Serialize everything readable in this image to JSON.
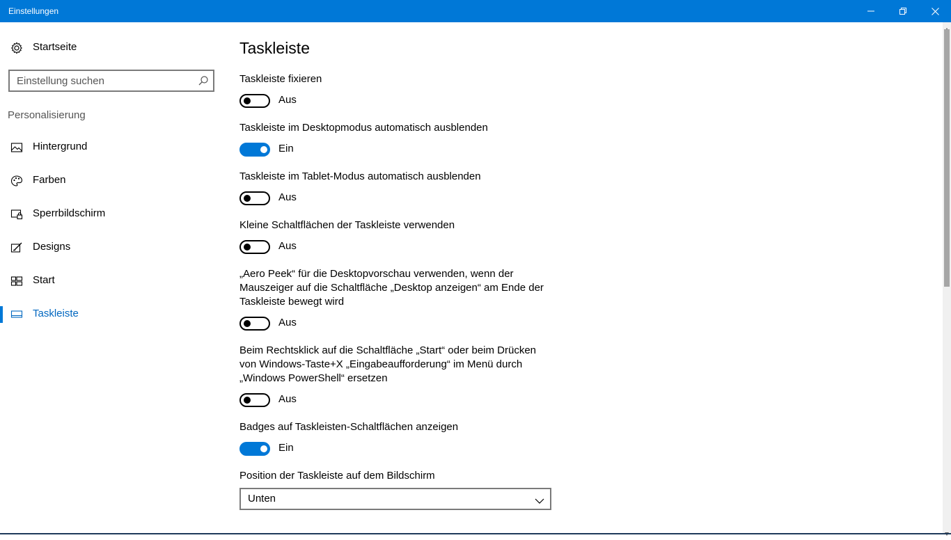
{
  "window": {
    "title": "Einstellungen",
    "accent_color": "#0078d7"
  },
  "sidebar": {
    "home_label": "Startseite",
    "search": {
      "placeholder": "Einstellung suchen",
      "value": ""
    },
    "section_title": "Personalisierung",
    "items": [
      {
        "label": "Hintergrund",
        "icon": "picture-icon",
        "active": false
      },
      {
        "label": "Farben",
        "icon": "palette-icon",
        "active": false
      },
      {
        "label": "Sperrbildschirm",
        "icon": "lock-screen-icon",
        "active": false
      },
      {
        "label": "Designs",
        "icon": "designs-icon",
        "active": false
      },
      {
        "label": "Start",
        "icon": "start-icon",
        "active": false
      },
      {
        "label": "Taskleiste",
        "icon": "taskbar-icon",
        "active": true
      }
    ]
  },
  "main": {
    "title": "Taskleiste",
    "settings": [
      {
        "label": "Taskleiste fixieren",
        "on": false,
        "state_label": "Aus"
      },
      {
        "label": "Taskleiste im Desktopmodus automatisch ausblenden",
        "on": true,
        "state_label": "Ein"
      },
      {
        "label": "Taskleiste im Tablet-Modus automatisch ausblenden",
        "on": false,
        "state_label": "Aus"
      },
      {
        "label": "Kleine Schaltflächen der Taskleiste verwenden",
        "on": false,
        "state_label": "Aus"
      },
      {
        "label": "„Aero Peek“ für die Desktopvorschau verwenden, wenn der Mauszeiger auf die Schaltfläche „Desktop anzeigen“ am Ende der Taskleiste bewegt wird",
        "on": false,
        "state_label": "Aus"
      },
      {
        "label": "Beim Rechtsklick auf die Schaltfläche „Start“ oder beim Drücken von Windows-Taste+X „Eingabeaufforderung“ im Menü durch „Windows PowerShell“ ersetzen",
        "on": false,
        "state_label": "Aus"
      },
      {
        "label": "Badges auf Taskleisten-Schaltflächen anzeigen",
        "on": true,
        "state_label": "Ein"
      }
    ],
    "position": {
      "label": "Position der Taskleiste auf dem Bildschirm",
      "selected": "Unten"
    }
  }
}
